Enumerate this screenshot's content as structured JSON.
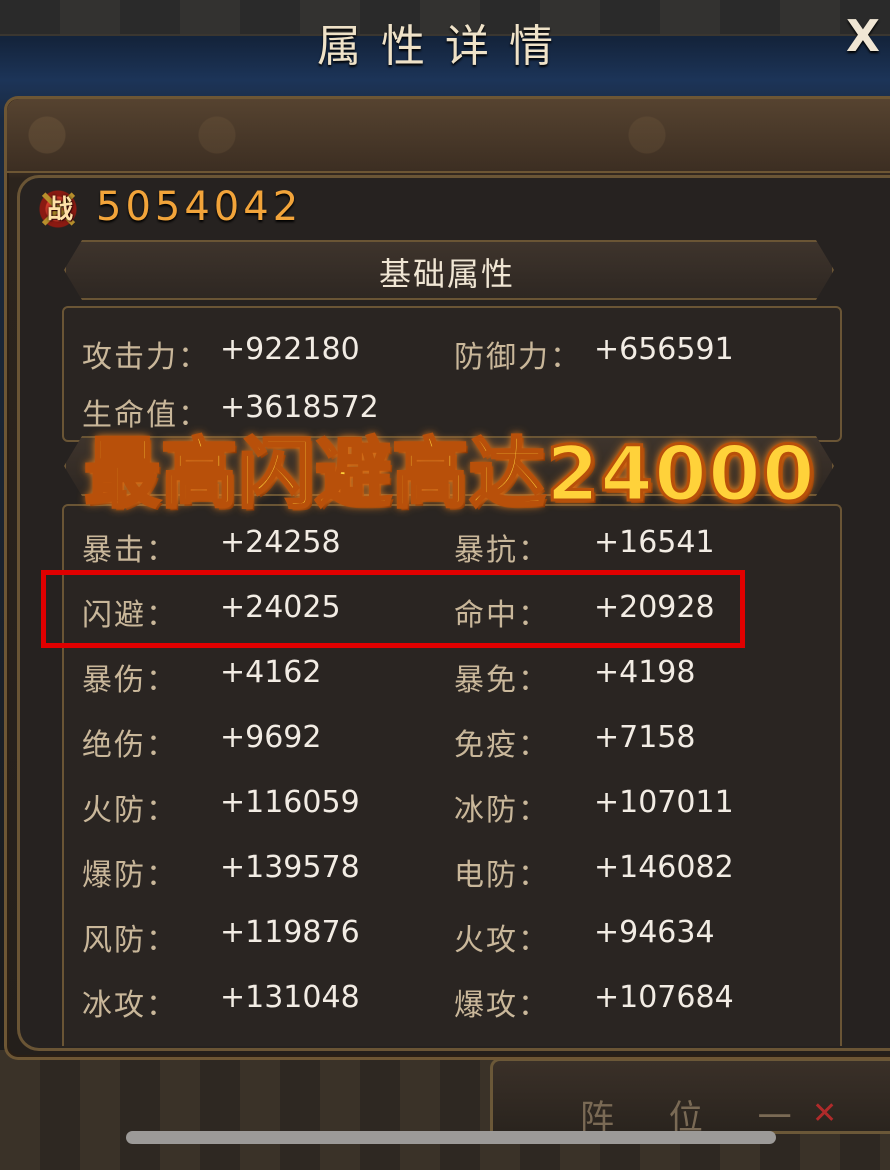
{
  "dialog": {
    "title": "属性详情",
    "close_label": "X"
  },
  "power": {
    "badge_char": "战",
    "value": "5054042"
  },
  "basic": {
    "title": "基础属性",
    "rows": [
      {
        "label_left": "攻击力：",
        "value_left": "+922180",
        "label_right": "防御力：",
        "value_right": "+656591"
      },
      {
        "label_left": "生命值：",
        "value_left": "+3618572",
        "label_right": "",
        "value_right": ""
      }
    ]
  },
  "overlay": {
    "headline": "最高闪避高达24000"
  },
  "advanced": {
    "rows": [
      {
        "label_left": "暴击：",
        "value_left": "+24258",
        "label_right": "暴抗：",
        "value_right": "+16541"
      },
      {
        "label_left": "闪避：",
        "value_left": "+24025",
        "label_right": "命中：",
        "value_right": "+20928"
      },
      {
        "label_left": "暴伤：",
        "value_left": "+4162",
        "label_right": "暴免：",
        "value_right": "+4198"
      },
      {
        "label_left": "绝伤：",
        "value_left": "+9692",
        "label_right": "免疫：",
        "value_right": "+7158"
      },
      {
        "label_left": "火防：",
        "value_left": "+116059",
        "label_right": "冰防：",
        "value_right": "+107011"
      },
      {
        "label_left": "爆防：",
        "value_left": "+139578",
        "label_right": "电防：",
        "value_right": "+146082"
      },
      {
        "label_left": "风防：",
        "value_left": "+119876",
        "label_right": "火攻：",
        "value_right": "+94634"
      },
      {
        "label_left": "冰攻：",
        "value_left": "+131048",
        "label_right": "爆攻：",
        "value_right": "+107684"
      }
    ]
  },
  "background": {
    "bottom_panel_text": "阵 位 一"
  },
  "colors": {
    "title_text": "#efe2c8",
    "label_text": "#c9b79a",
    "value_text": "#f2ece4",
    "power_value": "#f2a43a",
    "highlight_border": "#e00000",
    "headline_fill": "#ffd23a",
    "frame_border": "#6a5535"
  }
}
